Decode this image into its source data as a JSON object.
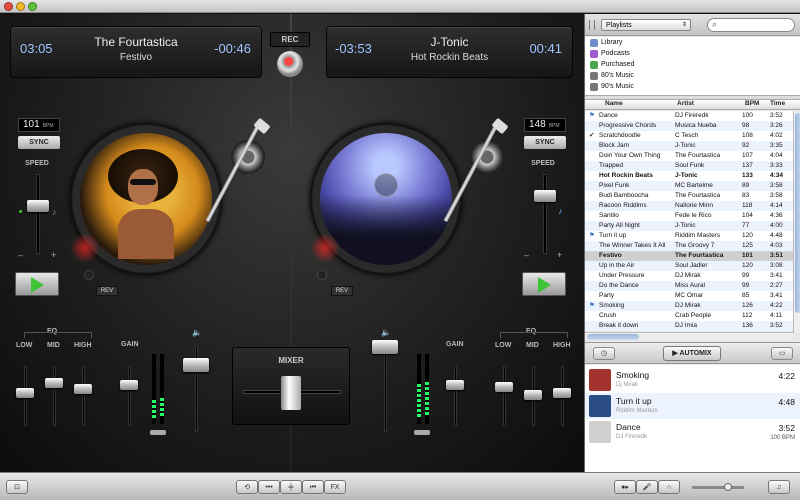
{
  "colors": {
    "accent_green": "#3ec436",
    "time_blue": "#9fc4ff",
    "meter_green": "#22ff66",
    "rec_red": "#ff4444",
    "row_alt": "#edf3fe"
  },
  "deck_left": {
    "title": "The Fourtastica",
    "subtitle": "Festivo",
    "elapsed": "03:05",
    "remaining": "-00:46",
    "bpm": "101",
    "bpm_unit": "BPM",
    "sync_label": "SYNC",
    "speed_label": "SPEED",
    "minus": "–",
    "plus": "+",
    "rev_label": "REV",
    "play_icon": "play-icon"
  },
  "deck_right": {
    "title": "J-Tonic",
    "subtitle": "Hot Rockin Beats",
    "elapsed": "-03:53",
    "remaining": "00:41",
    "bpm": "148",
    "bpm_unit": "BPM",
    "sync_label": "SYNC",
    "speed_label": "SPEED",
    "minus": "–",
    "plus": "+",
    "rev_label": "REV",
    "play_icon": "play-icon"
  },
  "rec_label": "REC",
  "mixer": {
    "label": "MIXER",
    "eq_label": "EQ",
    "low": "LOW",
    "mid": "MID",
    "high": "HIGH",
    "gain": "GAIN"
  },
  "sidebar": {
    "playlist_select": "Playlists",
    "sources": [
      {
        "label": "Library",
        "color": "#6b8ec9"
      },
      {
        "label": "Podcasts",
        "color": "#a05cd0"
      },
      {
        "label": "Purchased",
        "color": "#4aa84a"
      },
      {
        "label": "80's Music",
        "color": "#777"
      },
      {
        "label": "90's Music",
        "color": "#777"
      }
    ],
    "columns": [
      "Name",
      "Artist",
      "BPM",
      "Time"
    ],
    "tracks": [
      {
        "mark": "flag",
        "name": "Dance",
        "artist": "DJ Fireredk",
        "bpm": "100",
        "time": "3:52"
      },
      {
        "mark": "",
        "name": "Progressive Chords",
        "artist": "Musica Nueba",
        "bpm": "98",
        "time": "3:26"
      },
      {
        "mark": "check",
        "name": "Scratchdoodle",
        "artist": "C Tesch",
        "bpm": "108",
        "time": "4:02"
      },
      {
        "mark": "",
        "name": "Block Jam",
        "artist": "J-Tonic",
        "bpm": "92",
        "time": "3:35"
      },
      {
        "mark": "",
        "name": "Doin Your Own Thing",
        "artist": "The Fourtastica",
        "bpm": "107",
        "time": "4:04"
      },
      {
        "mark": "",
        "name": "Trapped",
        "artist": "Soul Funk",
        "bpm": "137",
        "time": "3:33"
      },
      {
        "mark": "",
        "name": "Hot Rockin Beats",
        "artist": "J-Tonic",
        "bpm": "133",
        "time": "4:34",
        "bold": true
      },
      {
        "mark": "",
        "name": "Pixel Funk",
        "artist": "MC Bartelme",
        "bpm": "89",
        "time": "3:58"
      },
      {
        "mark": "",
        "name": "Budi Bamboocha",
        "artist": "The Fourtastica",
        "bpm": "83",
        "time": "3:58"
      },
      {
        "mark": "",
        "name": "Racoon Riddims",
        "artist": "Nallorie Minn",
        "bpm": "118",
        "time": "4:14"
      },
      {
        "mark": "",
        "name": "Santilo",
        "artist": "Fede le Rico",
        "bpm": "104",
        "time": "4:36"
      },
      {
        "mark": "",
        "name": "Party All Night",
        "artist": "J-Tonic",
        "bpm": "77",
        "time": "4:00"
      },
      {
        "mark": "flag",
        "name": "Turn it up",
        "artist": "Riddim Masters",
        "bpm": "120",
        "time": "4:48"
      },
      {
        "mark": "",
        "name": "The Winner Takes It All",
        "artist": "The Groovy 7",
        "bpm": "125",
        "time": "4:03"
      },
      {
        "mark": "",
        "name": "Festivo",
        "artist": "The Fourtastica",
        "bpm": "101",
        "time": "3:51",
        "bold": true,
        "selected": true
      },
      {
        "mark": "",
        "name": "Up in the Air",
        "artist": "Soul Jadler",
        "bpm": "120",
        "time": "3:08"
      },
      {
        "mark": "",
        "name": "Under Pressure",
        "artist": "DJ Mirak",
        "bpm": "99",
        "time": "3:41"
      },
      {
        "mark": "",
        "name": "Do the Dance",
        "artist": "Miss Aural",
        "bpm": "99",
        "time": "2:27"
      },
      {
        "mark": "",
        "name": "Party",
        "artist": "MC Omar",
        "bpm": "85",
        "time": "3:41"
      },
      {
        "mark": "flag",
        "name": "Smoking",
        "artist": "DJ Mirak",
        "bpm": "126",
        "time": "4:22"
      },
      {
        "mark": "",
        "name": "Crush",
        "artist": "Crab People",
        "bpm": "112",
        "time": "4:11"
      },
      {
        "mark": "",
        "name": "Break it down",
        "artist": "DJ Imia",
        "bpm": "136",
        "time": "3:52"
      }
    ],
    "automix_label": "AUTOMIX",
    "queue": [
      {
        "title": "Smoking",
        "artist": "Dj Mirak",
        "duration": "4:22",
        "bpm": "",
        "art": "#a4322d"
      },
      {
        "title": "Turn it up",
        "artist": "Riddim Masters",
        "duration": "4:48",
        "bpm": "",
        "art": "#2b4d86"
      },
      {
        "title": "Dance",
        "artist": "DJ Fireredk",
        "duration": "3:52",
        "bpm": "100 BPM",
        "art": "#cfcfcf"
      }
    ]
  },
  "bottombar": {
    "fx_label": "FX"
  }
}
